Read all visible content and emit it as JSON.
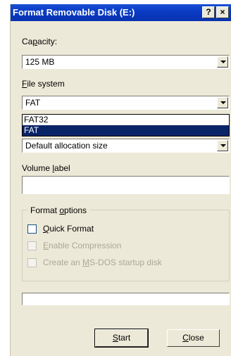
{
  "window": {
    "title": "Format Removable Disk (E:)",
    "help_button": "?",
    "close_button": "×"
  },
  "capacity": {
    "label_pre": "Ca",
    "label_accel": "p",
    "label_post": "acity:",
    "value": "125 MB"
  },
  "file_system": {
    "label_accel": "F",
    "label_post": "ile system",
    "value": "FAT",
    "options": [
      "FAT32",
      "FAT"
    ],
    "selected_index": 1
  },
  "allocation": {
    "value": "Default allocation size"
  },
  "volume_label": {
    "label_pre": "Volume ",
    "label_accel": "l",
    "label_post": "abel",
    "value": ""
  },
  "format_options": {
    "legend_pre": "Format ",
    "legend_accel": "o",
    "legend_post": "ptions",
    "quick_format": {
      "accel": "Q",
      "rest": "uick Format",
      "checked": false,
      "enabled": true
    },
    "enable_compression": {
      "accel": "E",
      "rest": "nable Compression",
      "checked": false,
      "enabled": false
    },
    "startup_disk": {
      "pre": "Create an ",
      "accel": "M",
      "rest": "S-DOS startup disk",
      "checked": false,
      "enabled": false
    }
  },
  "progress": {
    "value": 0
  },
  "buttons": {
    "start_accel": "S",
    "start_rest": "tart",
    "close_accel": "C",
    "close_rest": "lose"
  },
  "colors": {
    "titlebar": "#0a3cc4",
    "dialog_bg": "#ece9d8",
    "selection": "#0a2468"
  }
}
